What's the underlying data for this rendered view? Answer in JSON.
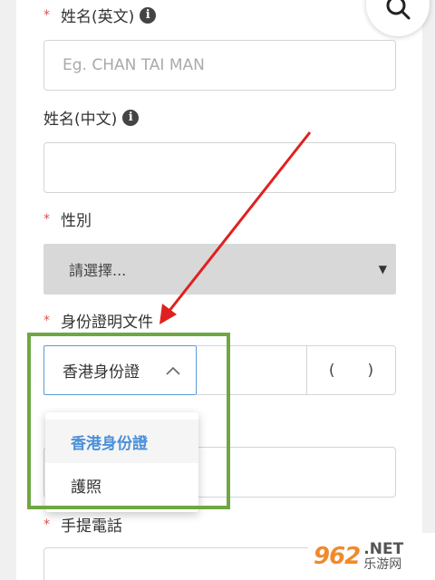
{
  "form": {
    "name_en": {
      "label": "姓名(英文)",
      "placeholder": "Eg. CHAN TAI MAN",
      "required_mark": "*"
    },
    "name_zh": {
      "label": "姓名(中文)",
      "value": ""
    },
    "gender": {
      "label": "性別",
      "required_mark": "*",
      "selected": "請選擇..."
    },
    "id_doc": {
      "label": "身份證明文件",
      "required_mark": "*",
      "selected": "香港身份證",
      "check_open": "(",
      "check_close": ")",
      "options": [
        "香港身份證",
        "護照"
      ]
    },
    "mobile": {
      "label": "手提電話",
      "required_mark": "*"
    }
  },
  "icons": {
    "info": "i",
    "search": "search-icon",
    "chevron_up": "chevron-up-icon",
    "caret_down": "▼"
  },
  "colors": {
    "required": "#d9534f",
    "highlight": "#6fa742",
    "arrow": "#e02020",
    "selected_option": "#4a90d9",
    "select_border": "#5b9bd5"
  },
  "watermark": {
    "logo": "962",
    "net": ".NET",
    "cn": "乐游网"
  }
}
